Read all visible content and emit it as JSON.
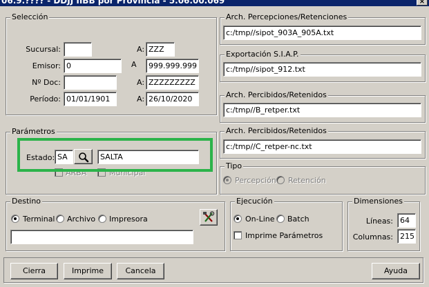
{
  "window": {
    "title": "06.9.???? - DDJJ IIBB por Provincia - 5.06.00.069",
    "close_glyph": "×"
  },
  "seleccion": {
    "legend": "Selección",
    "sucursal_label": "Sucursal:",
    "sucursal_from": "",
    "sucursal_to_label": "A:",
    "sucursal_to": "ZZZ",
    "emisor_label": "Emisor:",
    "emisor_from": "0",
    "emisor_to_label": "A",
    "emisor_to": "999.999.999",
    "nodoc_label": "Nº Doc:",
    "nodoc_from": "",
    "nodoc_to_label": "A:",
    "nodoc_to": "ZZZZZZZZZ",
    "periodo_label": "Período:",
    "periodo_from": "01/01/1901",
    "periodo_to_label": "A:",
    "periodo_to": "26/10/2020"
  },
  "parametros": {
    "legend": "Parámetros",
    "estado_label": "Estado:",
    "estado_code": "SA",
    "estado_name": "SALTA",
    "arba_label": "ARBA",
    "municipal_label": "Municipal"
  },
  "files": {
    "percepciones_legend": "Arch. Percepciones/Retenciones",
    "percepciones_path": "c:/tmp//sipot_903A_905A.txt",
    "siap_legend": "Exportación S.I.A.P.",
    "siap_path": "c:/tmp//sipot_912.txt",
    "percibidos1_legend": "Arch. Percibidos/Retenidos",
    "percibidos1_path": "c:/tmp//B_retper.txt",
    "percibidos2_legend": "Arch. Percibidos/Retenidos",
    "percibidos2_path": "c:/tmp//C_retper-nc.txt"
  },
  "tipo": {
    "legend": "Tipo",
    "percepcion_label": "Percepción",
    "retencion_label": "Retención",
    "selected": "Percepción"
  },
  "destino": {
    "legend": "Destino",
    "terminal_label": "Terminal",
    "archivo_label": "Archivo",
    "impresora_label": "Impresora",
    "selected": "Terminal",
    "path_value": ""
  },
  "ejecucion": {
    "legend": "Ejecución",
    "online_label": "On-Line",
    "batch_label": "Batch",
    "selected": "On-Line",
    "imprime_label": "Imprime Parámetros",
    "imprime_checked": false
  },
  "dimensiones": {
    "legend": "Dimensiones",
    "lineas_label": "Líneas:",
    "lineas_value": "64",
    "columnas_label": "Columnas:",
    "columnas_value": "215"
  },
  "buttons": {
    "cierra": "Cierra",
    "imprime": "Imprime",
    "cancela": "Cancela",
    "ayuda": "Ayuda"
  },
  "colors": {
    "highlight": "#2cb34a",
    "face": "#d4d0c8",
    "title": "#0a246a"
  }
}
